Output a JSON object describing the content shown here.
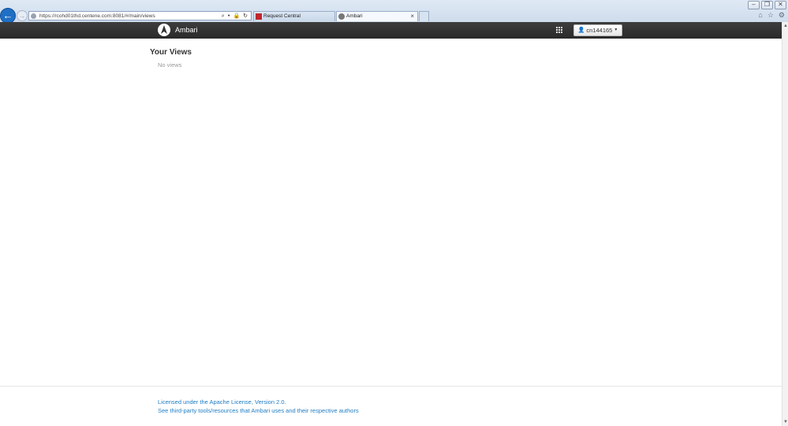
{
  "browser": {
    "address": "https://rcohd01thd.centene.com:8081/#/main/views",
    "address_tools": "⌕ ▾ 🔒 ↻",
    "tabs": [
      {
        "label": "Request Central"
      },
      {
        "label": "Ambari",
        "close": "×"
      }
    ],
    "window_controls": [
      "–",
      "❐",
      "✕"
    ]
  },
  "navbar": {
    "brand": "Ambari",
    "user_label": "cn144165",
    "caret": "▼"
  },
  "main": {
    "title": "Your Views",
    "empty_text": "No views"
  },
  "footer": {
    "license_link": "Licensed under the Apache License, Version 2.0.",
    "thirdparty_link": "See third-party tools/resources that Ambari uses and their respective authors"
  }
}
